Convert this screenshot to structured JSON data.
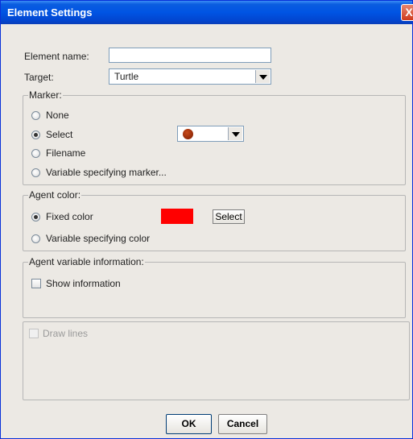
{
  "window": {
    "title": "Element Settings",
    "close_label": "X"
  },
  "form": {
    "element_name_label": "Element name:",
    "element_name_value": "",
    "target_label": "Target:",
    "target_value": "Turtle"
  },
  "marker": {
    "title": "Marker:",
    "options": [
      "None",
      "Select",
      "Filename",
      "Variable specifying marker..."
    ],
    "selected": "Select",
    "marker_color": "#a52a00"
  },
  "agent_color": {
    "title": "Agent color:",
    "options": [
      "Fixed color",
      "Variable specifying color"
    ],
    "selected": "Fixed color",
    "swatch_color": "#ff0000",
    "select_button": "Select"
  },
  "agent_variable": {
    "title": "Agent variable information:",
    "show_information_label": "Show information"
  },
  "draw_lines": {
    "label": "Draw lines"
  },
  "buttons": {
    "ok": "OK",
    "cancel": "Cancel"
  }
}
